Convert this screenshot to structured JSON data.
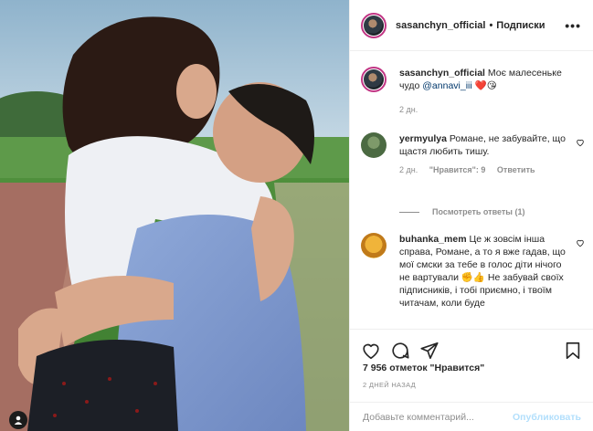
{
  "header": {
    "username": "sasanchyn_official",
    "separator": "•",
    "follow_label": "Подписки",
    "more_icon": "more-horizontal-icon",
    "more_text": "•••"
  },
  "caption": {
    "username": "sasanchyn_official",
    "text": "Моє малесеньке чудо",
    "mention": "@annavi_iii",
    "emoji": "❤️😘",
    "time": "2 дн."
  },
  "comments": [
    {
      "username": "yermyulya",
      "text": "Романе, не забувайте, що щастя любить тишу.",
      "time": "2 дн.",
      "likes": "\"Нравится\": 9",
      "reply": "Ответить",
      "view_replies": "Посмотреть ответы (1)"
    },
    {
      "username": "buhanka_mem",
      "text": "Це ж зовсім інша справа, Романе, а то я вже гадав, що мої смски за тебе в голос діти нічого не вартували ✊👍 Не забувай своїх підписників, і тобі приємно, і твоїм читачам, коли буде"
    }
  ],
  "actions": {
    "like_icon": "heart-icon",
    "comment_icon": "comment-icon",
    "share_icon": "paper-plane-icon",
    "save_icon": "bookmark-icon"
  },
  "likes_text": "7 956 отметок \"Нравится\"",
  "date_text": "2 ДНЕЙ НАЗАД",
  "composer": {
    "placeholder": "Добавьте комментарий...",
    "post_label": "Опубликовать"
  },
  "colors": {
    "border": "#efefef",
    "text": "#262626",
    "muted": "#8e8e8e",
    "link": "#00376b",
    "post_disabled": "#b2dffc",
    "story_ring": "#c13584"
  }
}
